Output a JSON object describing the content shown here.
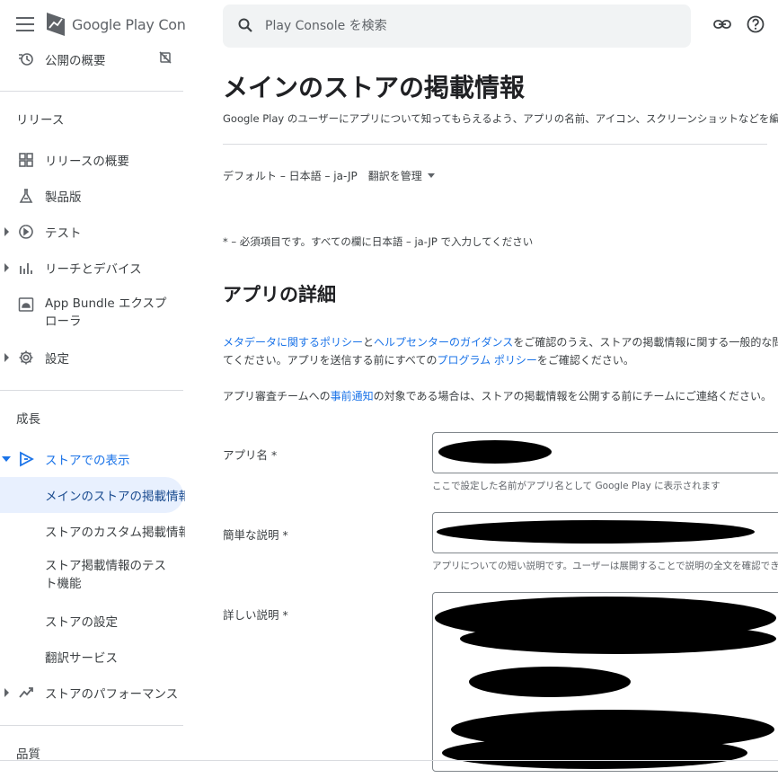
{
  "app": {
    "logo_text": "Google Play Console",
    "brand_color": "#1a73e8",
    "selected_bg": "#e8f0fe"
  },
  "search": {
    "placeholder": "Play Console を検索",
    "value": ""
  },
  "sidebar": {
    "top_item": "公開の概要",
    "section_release": "リリース",
    "release_items": [
      {
        "label": "リリースの概要",
        "icon": "dashboard-icon"
      },
      {
        "label": "製品版",
        "icon": "flask-icon"
      },
      {
        "label": "テスト",
        "icon": "test-icon"
      },
      {
        "label": "リーチとデバイス",
        "icon": "bar-chart-icon"
      },
      {
        "label": "App Bundle エクスプローラ",
        "icon": "android-bundle-icon"
      },
      {
        "label": "設定",
        "icon": "gear-icon"
      }
    ],
    "section_growth": "成長",
    "growth_parent": "ストアでの表示",
    "growth_items": [
      "メインのストアの掲載情報",
      "ストアのカスタム掲載情報",
      "ストア掲載情報のテスト機能",
      "ストアの設定",
      "翻訳サービス"
    ],
    "store_performance": "ストアのパフォーマンス",
    "section_quality": "品質"
  },
  "main": {
    "title": "メインのストアの掲載情報",
    "description": "Google Play のユーザーにアプリについて知ってもらえるよう、アプリの名前、アイコン、スクリーンショットなどを編集",
    "language": "デフォルト – 日本語 – ja-JP",
    "manage_translations": "翻訳を管理",
    "required_note": "* – 必須項目です。すべての欄に日本語 – ja-JP で入力してください",
    "section_title": "アプリの詳細",
    "para1": {
      "link1": "メタデータに関するポリシー",
      "t1": "と",
      "link2": "ヘルプセンターのガイダンス",
      "t2": "をご確認のうえ、ストアの掲載情報に関する一般的な問題が発",
      "t3": "てください。アプリを送信する前にすべての",
      "link3": "プログラム ポリシー",
      "t4": "をご確認ください。"
    },
    "para2": {
      "t1": "アプリ審査チームへの",
      "link": "事前通知",
      "t2": "の対象である場合は、ストアの掲載情報を公開する前にチームにご連絡ください。"
    },
    "fields": [
      {
        "label": "アプリ名 *",
        "helper": "ここで設定した名前がアプリ名として Google Play に表示されます"
      },
      {
        "label": "簡単な説明 *",
        "helper": "アプリについての短い説明です。ユーザーは展開することで説明の全文を確認できます"
      },
      {
        "label": "詳しい説明 *",
        "helper": ""
      }
    ]
  }
}
